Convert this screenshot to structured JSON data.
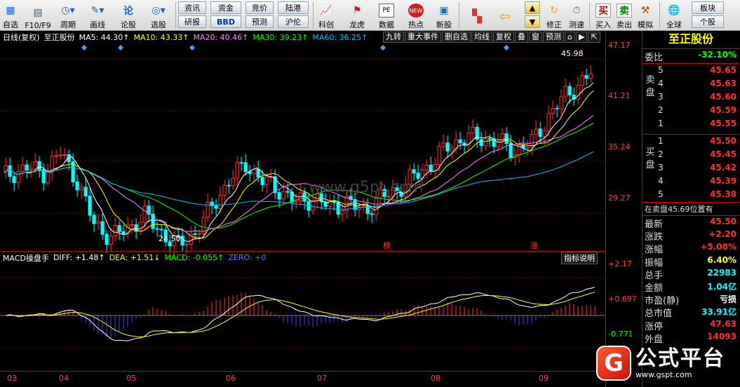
{
  "toolbar": {
    "row1": [
      {
        "name": "self-select",
        "label": "自选"
      },
      {
        "name": "f10",
        "label": "F10/F9"
      },
      {
        "name": "period",
        "label": "周期"
      },
      {
        "name": "draw",
        "label": "画线"
      },
      {
        "name": "stock-comment",
        "label": "论股"
      },
      {
        "name": "select-stock",
        "label": "选股"
      }
    ],
    "small_buttons": {
      "news": "资讯",
      "fund": "资金",
      "auction": "竞价",
      "hk_connect": "陆港",
      "research": "研报",
      "bbd": "BBD",
      "forecast": "预测",
      "sh_hk": "沪伦"
    },
    "row2": [
      {
        "name": "tech",
        "label": "科创"
      },
      {
        "name": "dragon-tiger",
        "label": "龙虎"
      },
      {
        "name": "data",
        "label": "数据"
      },
      {
        "name": "hot",
        "label": "热点"
      },
      {
        "name": "new-stock",
        "label": "新股"
      }
    ],
    "row3": [
      {
        "name": "correct",
        "label": "修正"
      },
      {
        "name": "speed-test",
        "label": "测速"
      },
      {
        "name": "buy",
        "label": "买入"
      },
      {
        "name": "sell",
        "label": "卖出"
      },
      {
        "name": "simulate",
        "label": "模拟"
      },
      {
        "name": "global",
        "label": "全球"
      },
      {
        "name": "sector",
        "label": "板块"
      },
      {
        "name": "individual",
        "label": "个股"
      }
    ],
    "icon_labels": {
      "up": "上",
      "down": "下",
      "self": "自",
      "bbd_icon": "BBD",
      "pe": "PE",
      "new": "NEW",
      "buy_char": "买",
      "sell_char": "卖"
    }
  },
  "chart": {
    "title": "日线(复权)",
    "stock": "至正股份",
    "ma": [
      {
        "label": "MA5: 44.30↑",
        "color": "#ffffff"
      },
      {
        "label": "MA10: 43.33↑",
        "color": "#ffff00"
      },
      {
        "label": "MA20: 40.46↑",
        "color": "#ff80ff"
      },
      {
        "label": "MA30: 39.23↑",
        "color": "#00ff00"
      },
      {
        "label": "MA60: 36.25↑",
        "color": "#00c0ff"
      }
    ],
    "chart_toolbar": [
      "九转",
      "重大事件",
      "删自选",
      "均线",
      "复权",
      "叠",
      "窗",
      "预测",
      "⌂",
      "▶",
      "⇱"
    ],
    "y_axis": [
      "47.17",
      "41.21",
      "35.24",
      "29.27"
    ],
    "macd_axis": [
      "+2.17",
      "+0.697",
      "-0.771"
    ],
    "high_label": "45.98",
    "low_label": "24.50",
    "marker_bang": "榜",
    "marker_up": "涨",
    "macd": {
      "title": "MACD操盘手",
      "diff": "DIFF: +1.48↑",
      "dea": "DEA: +1.51↓",
      "macd": "MACD: -0.055↑",
      "zero": "ZERO: +0",
      "help": "指标说明"
    },
    "x_axis": [
      "03",
      "04",
      "05",
      "06",
      "07",
      "08",
      "09"
    ],
    "watermark": "www.g5pt.com"
  },
  "panel": {
    "name": "至正股份",
    "weibi_label": "委比",
    "weibi_value": "-32.10%",
    "sell_side": "卖盘",
    "buy_side": "买盘",
    "sell_orders": [
      {
        "level": "5",
        "price": "45.65"
      },
      {
        "level": "4",
        "price": "45.63"
      },
      {
        "level": "3",
        "price": "45.60"
      },
      {
        "level": "2",
        "price": "45.59"
      },
      {
        "level": "1",
        "price": "45.55"
      }
    ],
    "buy_orders": [
      {
        "level": "1",
        "price": "45.50"
      },
      {
        "level": "2",
        "price": "45.45"
      },
      {
        "level": "3",
        "price": "45.42"
      },
      {
        "level": "4",
        "price": "45.39"
      },
      {
        "level": "5",
        "price": "45.38"
      }
    ],
    "position_text": "在卖盘45.69位置有",
    "stats": [
      {
        "label": "最新",
        "value": "45.50",
        "color": "red"
      },
      {
        "label": "涨跌",
        "value": "+2.20",
        "color": "red"
      },
      {
        "label": "涨幅",
        "value": "+5.08%",
        "color": "red"
      },
      {
        "label": "振幅",
        "value": "6.40%",
        "color": "yellow"
      },
      {
        "label": "总手",
        "value": "22983",
        "color": "cyan"
      },
      {
        "label": "金额",
        "value": "1.04亿",
        "color": "cyan"
      },
      {
        "label": "市盈(静)",
        "value": "亏损",
        "color": "white"
      },
      {
        "label": "总市值",
        "value": "33.91亿",
        "color": "cyan"
      },
      {
        "label": "涨停",
        "value": "47.63",
        "color": "red"
      },
      {
        "label": "外盘",
        "value": "14093",
        "color": "red"
      }
    ]
  },
  "logo": {
    "g": "G",
    "title": "公式平台",
    "url": "www.gspt.com"
  }
}
